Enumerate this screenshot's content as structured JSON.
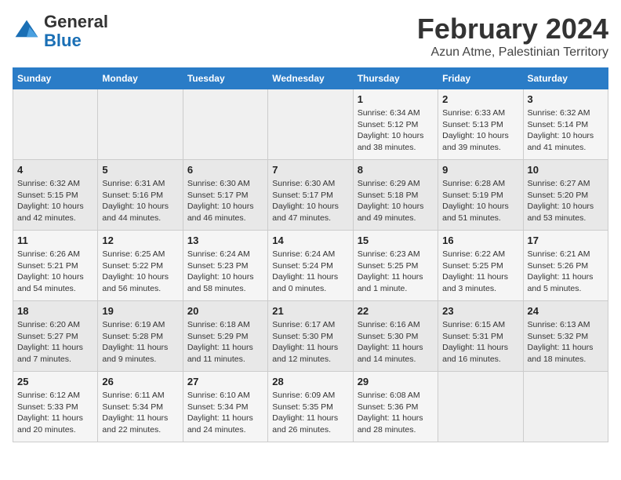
{
  "header": {
    "logo_line1": "General",
    "logo_line2": "Blue",
    "title": "February 2024",
    "subtitle": "Azun Atme, Palestinian Territory"
  },
  "weekdays": [
    "Sunday",
    "Monday",
    "Tuesday",
    "Wednesday",
    "Thursday",
    "Friday",
    "Saturday"
  ],
  "weeks": [
    [
      {
        "day": "",
        "info": ""
      },
      {
        "day": "",
        "info": ""
      },
      {
        "day": "",
        "info": ""
      },
      {
        "day": "",
        "info": ""
      },
      {
        "day": "1",
        "info": "Sunrise: 6:34 AM\nSunset: 5:12 PM\nDaylight: 10 hours\nand 38 minutes."
      },
      {
        "day": "2",
        "info": "Sunrise: 6:33 AM\nSunset: 5:13 PM\nDaylight: 10 hours\nand 39 minutes."
      },
      {
        "day": "3",
        "info": "Sunrise: 6:32 AM\nSunset: 5:14 PM\nDaylight: 10 hours\nand 41 minutes."
      }
    ],
    [
      {
        "day": "4",
        "info": "Sunrise: 6:32 AM\nSunset: 5:15 PM\nDaylight: 10 hours\nand 42 minutes."
      },
      {
        "day": "5",
        "info": "Sunrise: 6:31 AM\nSunset: 5:16 PM\nDaylight: 10 hours\nand 44 minutes."
      },
      {
        "day": "6",
        "info": "Sunrise: 6:30 AM\nSunset: 5:17 PM\nDaylight: 10 hours\nand 46 minutes."
      },
      {
        "day": "7",
        "info": "Sunrise: 6:30 AM\nSunset: 5:17 PM\nDaylight: 10 hours\nand 47 minutes."
      },
      {
        "day": "8",
        "info": "Sunrise: 6:29 AM\nSunset: 5:18 PM\nDaylight: 10 hours\nand 49 minutes."
      },
      {
        "day": "9",
        "info": "Sunrise: 6:28 AM\nSunset: 5:19 PM\nDaylight: 10 hours\nand 51 minutes."
      },
      {
        "day": "10",
        "info": "Sunrise: 6:27 AM\nSunset: 5:20 PM\nDaylight: 10 hours\nand 53 minutes."
      }
    ],
    [
      {
        "day": "11",
        "info": "Sunrise: 6:26 AM\nSunset: 5:21 PM\nDaylight: 10 hours\nand 54 minutes."
      },
      {
        "day": "12",
        "info": "Sunrise: 6:25 AM\nSunset: 5:22 PM\nDaylight: 10 hours\nand 56 minutes."
      },
      {
        "day": "13",
        "info": "Sunrise: 6:24 AM\nSunset: 5:23 PM\nDaylight: 10 hours\nand 58 minutes."
      },
      {
        "day": "14",
        "info": "Sunrise: 6:24 AM\nSunset: 5:24 PM\nDaylight: 11 hours\nand 0 minutes."
      },
      {
        "day": "15",
        "info": "Sunrise: 6:23 AM\nSunset: 5:25 PM\nDaylight: 11 hours\nand 1 minute."
      },
      {
        "day": "16",
        "info": "Sunrise: 6:22 AM\nSunset: 5:25 PM\nDaylight: 11 hours\nand 3 minutes."
      },
      {
        "day": "17",
        "info": "Sunrise: 6:21 AM\nSunset: 5:26 PM\nDaylight: 11 hours\nand 5 minutes."
      }
    ],
    [
      {
        "day": "18",
        "info": "Sunrise: 6:20 AM\nSunset: 5:27 PM\nDaylight: 11 hours\nand 7 minutes."
      },
      {
        "day": "19",
        "info": "Sunrise: 6:19 AM\nSunset: 5:28 PM\nDaylight: 11 hours\nand 9 minutes."
      },
      {
        "day": "20",
        "info": "Sunrise: 6:18 AM\nSunset: 5:29 PM\nDaylight: 11 hours\nand 11 minutes."
      },
      {
        "day": "21",
        "info": "Sunrise: 6:17 AM\nSunset: 5:30 PM\nDaylight: 11 hours\nand 12 minutes."
      },
      {
        "day": "22",
        "info": "Sunrise: 6:16 AM\nSunset: 5:30 PM\nDaylight: 11 hours\nand 14 minutes."
      },
      {
        "day": "23",
        "info": "Sunrise: 6:15 AM\nSunset: 5:31 PM\nDaylight: 11 hours\nand 16 minutes."
      },
      {
        "day": "24",
        "info": "Sunrise: 6:13 AM\nSunset: 5:32 PM\nDaylight: 11 hours\nand 18 minutes."
      }
    ],
    [
      {
        "day": "25",
        "info": "Sunrise: 6:12 AM\nSunset: 5:33 PM\nDaylight: 11 hours\nand 20 minutes."
      },
      {
        "day": "26",
        "info": "Sunrise: 6:11 AM\nSunset: 5:34 PM\nDaylight: 11 hours\nand 22 minutes."
      },
      {
        "day": "27",
        "info": "Sunrise: 6:10 AM\nSunset: 5:34 PM\nDaylight: 11 hours\nand 24 minutes."
      },
      {
        "day": "28",
        "info": "Sunrise: 6:09 AM\nSunset: 5:35 PM\nDaylight: 11 hours\nand 26 minutes."
      },
      {
        "day": "29",
        "info": "Sunrise: 6:08 AM\nSunset: 5:36 PM\nDaylight: 11 hours\nand 28 minutes."
      },
      {
        "day": "",
        "info": ""
      },
      {
        "day": "",
        "info": ""
      }
    ]
  ]
}
